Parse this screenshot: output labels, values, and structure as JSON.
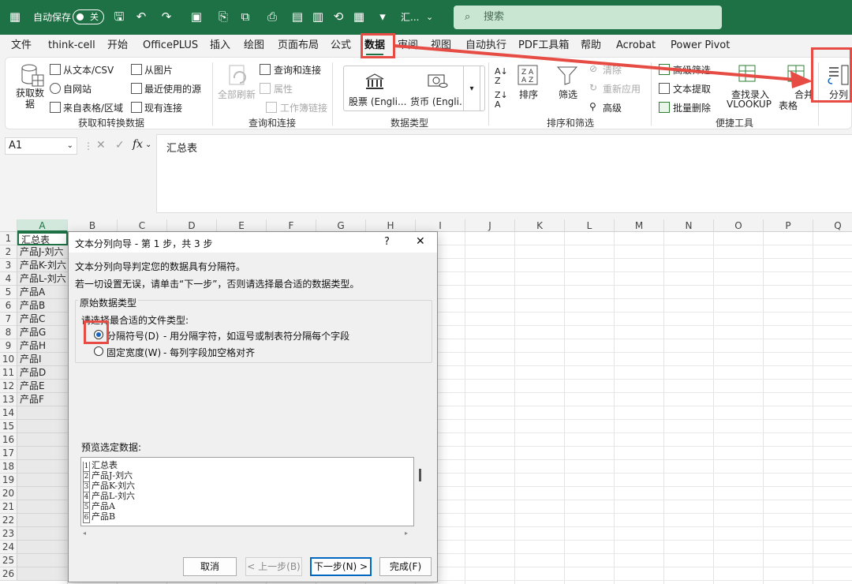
{
  "titlebar": {
    "autosave_label": "自动保存",
    "autosave_state": "关",
    "doc_title": "汇...",
    "search_placeholder": "搜索"
  },
  "menu": {
    "tabs": [
      "文件",
      "think-cell",
      "开始",
      "OfficePLUS",
      "插入",
      "绘图",
      "页面布局",
      "公式",
      "数据",
      "审阅",
      "视图",
      "自动执行",
      "PDF工具箱",
      "帮助",
      "Acrobat",
      "Power Pivot"
    ],
    "active": "数据"
  },
  "ribbon": {
    "get_data": {
      "big": "获取数据",
      "from_text_csv": "从文本/CSV",
      "from_web": "自网站",
      "from_table": "来自表格/区域",
      "from_picture": "从图片",
      "recent_sources": "最近使用的源",
      "existing_connections": "现有连接",
      "group": "获取和转换数据"
    },
    "queries": {
      "refresh_all": "全部刷新",
      "queries_connections": "查询和连接",
      "properties": "属性",
      "workbook_links": "工作簿链接",
      "group": "查询和连接"
    },
    "datatypes": {
      "stocks": "股票 (Engli...",
      "currencies": "货币 (Engli...",
      "group": "数据类型"
    },
    "sort_filter": {
      "sort": "排序",
      "filter": "筛选",
      "clear": "清除",
      "reapply": "重新应用",
      "advanced": "高级",
      "group": "排序和筛选"
    },
    "tools": {
      "adv_filter": "高级筛选",
      "text_extract": "文本提取",
      "batch_delete": "批量删除",
      "lookup_line1": "查找录入",
      "lookup_line2": "VLOOKUP",
      "merge_line1": "合并",
      "merge_line2": "表格",
      "group": "便捷工具"
    },
    "split": "分列"
  },
  "formula": {
    "namebox": "A1",
    "fx": "fx",
    "value": "汇总表"
  },
  "grid": {
    "columns": [
      "A",
      "B",
      "C",
      "D",
      "E",
      "F",
      "G",
      "H",
      "I",
      "J",
      "K",
      "L",
      "M",
      "N",
      "O",
      "P",
      "Q"
    ],
    "rows": [
      "1",
      "2",
      "3",
      "4",
      "5",
      "6",
      "7",
      "8",
      "9",
      "10",
      "11",
      "12",
      "13",
      "14",
      "15",
      "16",
      "17",
      "18",
      "19",
      "20",
      "21",
      "22",
      "23",
      "24",
      "25",
      "26"
    ],
    "col_a": [
      "汇总表",
      "产品J-刘六",
      "产品K-刘六",
      "产品L-刘六",
      "产品A",
      "产品B",
      "产品C",
      "产品G",
      "产品H",
      "产品I",
      "产品D",
      "产品E",
      "产品F"
    ]
  },
  "dialog": {
    "title": "文本分列向导 - 第 1 步，共 3 步",
    "help": "?",
    "close": "✕",
    "intro1": "文本分列向导判定您的数据具有分隔符。",
    "intro2": "若一切设置无误，请单击“下一步”，否则请选择最合适的数据类型。",
    "group_title": "原始数据类型",
    "choose_label": "请选择最合适的文件类型:",
    "opt_delimited": "分隔符号(D)",
    "opt_delimited_desc": "- 用分隔字符，如逗号或制表符分隔每个字段",
    "opt_fixed": "固定宽度(W)",
    "opt_fixed_desc": "- 每列字段加空格对齐",
    "preview_label": "预览选定数据:",
    "preview_lines": [
      {
        "n": "1",
        "t": "汇总表"
      },
      {
        "n": "2",
        "t": "产品J-刘六"
      },
      {
        "n": "3",
        "t": "产品K-刘六"
      },
      {
        "n": "4",
        "t": "产品L-刘六"
      },
      {
        "n": "5",
        "t": "产品A"
      },
      {
        "n": "6",
        "t": "产品B"
      }
    ],
    "btn_cancel": "取消",
    "btn_back": "< 上一步(B)",
    "btn_next": "下一步(N) >",
    "btn_finish": "完成(F)"
  },
  "colors": {
    "excel_green": "#1e7145",
    "annotation_red": "#e64c44",
    "radio_blue": "#1565c0"
  }
}
